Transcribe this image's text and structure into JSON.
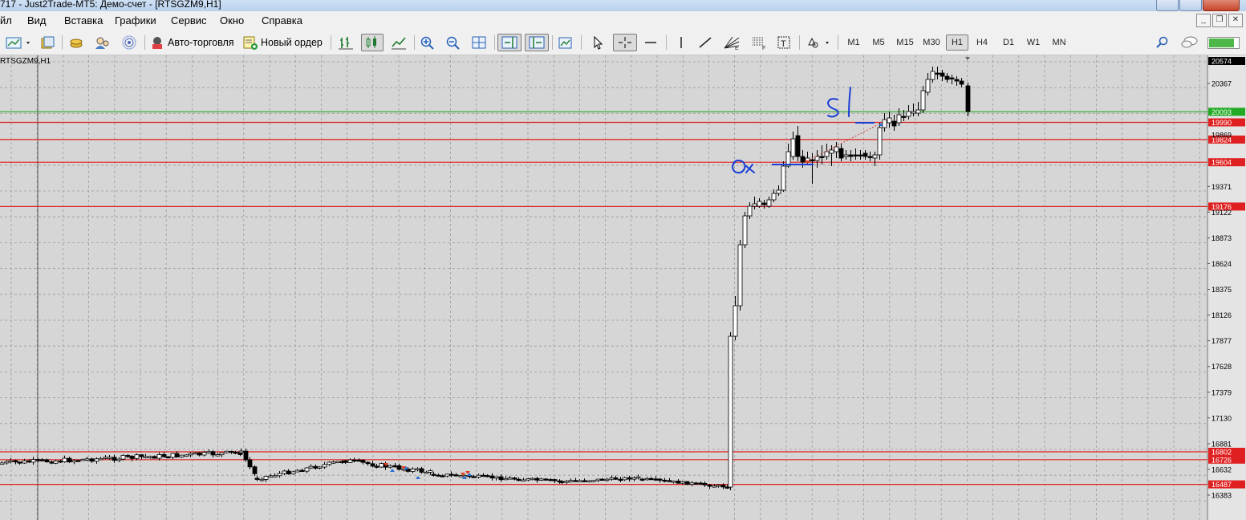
{
  "window": {
    "title": "717 - Just2Trade-MT5: Демо-счет - [RTSGZM9,H1]"
  },
  "menu": [
    "йл",
    "Вид",
    "Вставка",
    "Графики",
    "Сервис",
    "Окно",
    "Справка"
  ],
  "toolbar": {
    "auto_trading_label": "Авто-торговля",
    "new_order_label": "Новый ордер",
    "timeframes": [
      "M1",
      "M5",
      "M15",
      "M30",
      "H1",
      "H4",
      "D1",
      "W1",
      "MN"
    ],
    "active_timeframe": "H1",
    "connection_fill": 0.85
  },
  "chart": {
    "symbol_title": "RTSGZM9,H1",
    "current_price": "20574",
    "y_ticks": [
      "20367",
      "19371",
      "19122",
      "18873",
      "18624",
      "18375",
      "18126",
      "17877",
      "17628",
      "17379",
      "17130",
      "16881",
      "16632",
      "16383"
    ],
    "y_labels_hidden": [
      "19869"
    ],
    "green_level": {
      "label": "20093",
      "price": 20093,
      "color": "#22aa22"
    },
    "red_levels": [
      {
        "label": "19990",
        "price": 19990
      },
      {
        "label": "19824",
        "price": 19824
      },
      {
        "label": "19604",
        "price": 19604
      },
      {
        "label": "19176",
        "price": 19176
      },
      {
        "label": "16802",
        "price": 16802
      },
      {
        "label": "16726",
        "price": 16726
      },
      {
        "label": "16487",
        "price": 16487
      }
    ],
    "level_color": "#e02020",
    "annotations": {
      "sl": "Sl",
      "ok": "Ok"
    },
    "accent_colors": {
      "background": "#d6d6d6",
      "grid": "#9a9a9a",
      "candle_up": "#ffffff",
      "candle_down": "#000000",
      "handwriting": "#1a3fd6"
    }
  }
}
